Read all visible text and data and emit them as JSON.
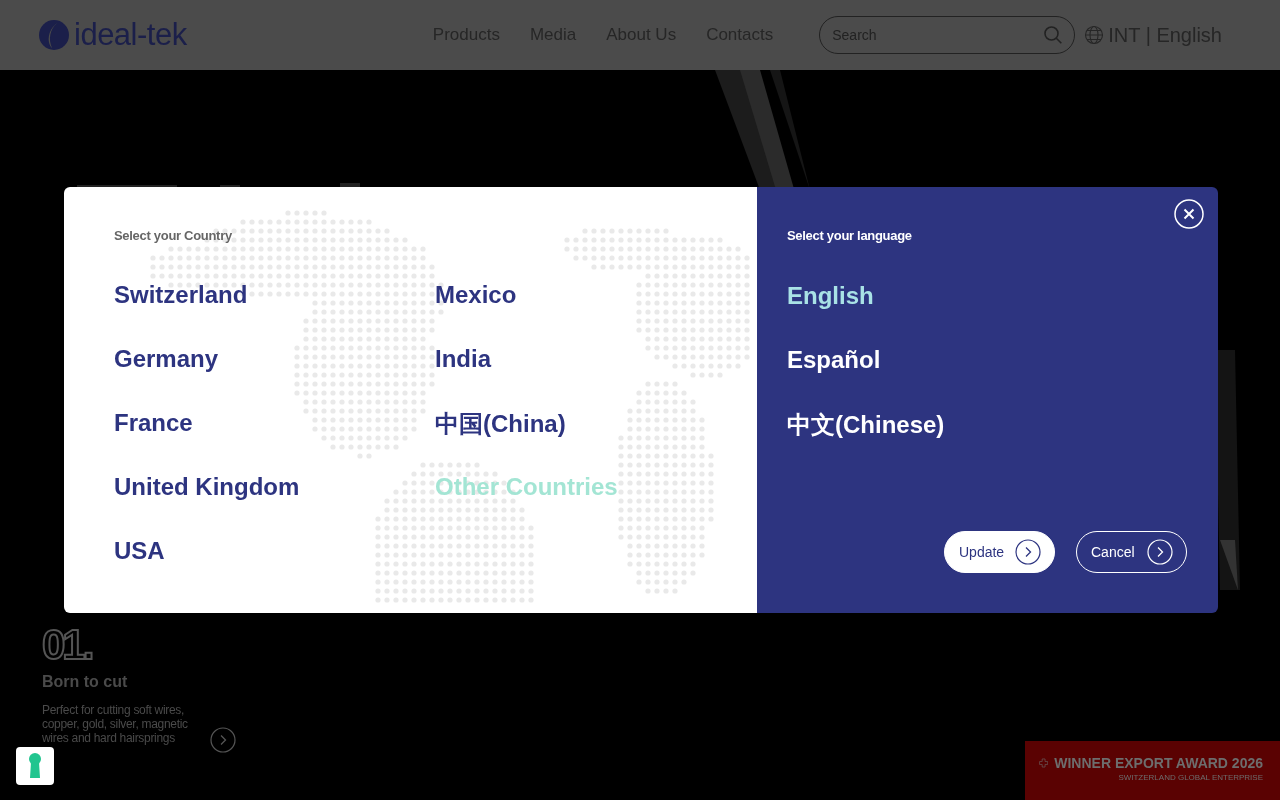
{
  "header": {
    "logo": "ideal-tek",
    "nav": [
      "Products",
      "Media",
      "About Us",
      "Contacts"
    ],
    "search": {
      "placeholder": "Search"
    },
    "locale": "INT | English"
  },
  "slide": {
    "number": "01.",
    "title": "Born to cut",
    "text": "Perfect for cutting soft wires, copper, gold, silver, magnetic wires and hard hairsprings"
  },
  "award": {
    "title": "WINNER EXPORT AWARD 2026",
    "subtitle": "SWITZERLAND GLOBAL ENTERPRISE"
  },
  "modal": {
    "country_title": "Select your Country",
    "countries": [
      {
        "label": "Switzerland",
        "selected": false
      },
      {
        "label": "Germany",
        "selected": false
      },
      {
        "label": "France",
        "selected": false
      },
      {
        "label": "United Kingdom",
        "selected": false
      },
      {
        "label": "USA",
        "selected": false
      },
      {
        "label": "Mexico",
        "selected": false
      },
      {
        "label": "India",
        "selected": false
      },
      {
        "label": "中国(China)",
        "selected": false
      },
      {
        "label": "Other Countries",
        "selected": true
      }
    ],
    "language_title": "Select your language",
    "languages": [
      {
        "label": "English",
        "selected": true
      },
      {
        "label": "Español",
        "selected": false
      },
      {
        "label": "中文(Chinese)",
        "selected": false
      }
    ],
    "buttons": [
      {
        "label": "Update",
        "kind": "primary"
      },
      {
        "label": "Cancel",
        "kind": "outline"
      }
    ]
  }
}
